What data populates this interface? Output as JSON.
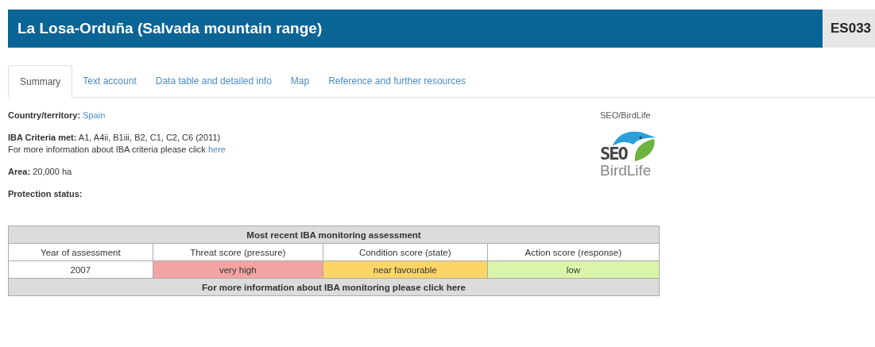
{
  "header": {
    "title": "La Losa-Orduña (Salvada mountain range)",
    "code": "ES033"
  },
  "tabs": [
    {
      "label": "Summary",
      "selected": true
    },
    {
      "label": "Text account",
      "selected": false
    },
    {
      "label": "Data table and detailed info",
      "selected": false
    },
    {
      "label": "Map",
      "selected": false
    },
    {
      "label": "Reference and further resources",
      "selected": false
    }
  ],
  "country": {
    "label": "Country/territory:",
    "value": "Spain"
  },
  "criteria": {
    "label": "IBA Criteria met:",
    "value": "A1, A4ii, B1iii, B2, C1, C2, C6 (2011)",
    "more_text": "For more information about IBA criteria please click",
    "more_link": "here"
  },
  "area": {
    "label": "Area:",
    "value": "20,000 ha"
  },
  "protection": {
    "label": "Protection status:"
  },
  "partner": {
    "caption": "SEO/BirdLife",
    "logo_top": "SEO",
    "logo_bottom": "BirdLife"
  },
  "monitoring": {
    "title": "Most recent IBA monitoring assessment",
    "columns": [
      "Year of assessment",
      "Threat score (pressure)",
      "Condition score (state)",
      "Action score (response)"
    ],
    "cells": [
      {
        "text": "2007"
      },
      {
        "text": "very high",
        "color": "#f4a3a3"
      },
      {
        "text": "near favourable",
        "color": "#fdd567"
      },
      {
        "text": "low",
        "color": "#d9f5a8"
      }
    ],
    "footer": "For more information about IBA monitoring please click here"
  }
}
